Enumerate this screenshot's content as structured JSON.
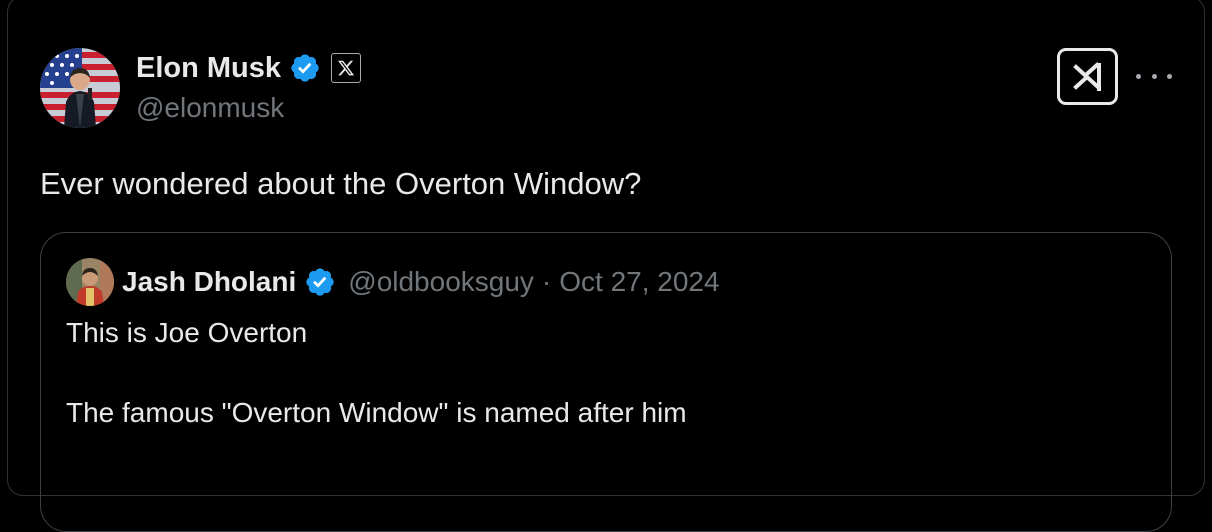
{
  "tweet": {
    "author_name": "Elon Musk",
    "author_handle": "@elonmusk",
    "text": "Ever wondered about the Overton Window?",
    "icons": {
      "verified": "verified-badge-icon",
      "affiliation": "x-logo-icon",
      "grok": "grok-icon",
      "more": "more-options-icon"
    }
  },
  "quoted_tweet": {
    "author_name": "Jash Dholani",
    "author_handle": "@oldbooksguy",
    "separator": "·",
    "date": "Oct 27, 2024",
    "lines": [
      "This is Joe Overton",
      "The famous \"Overton Window\" is named after him"
    ]
  },
  "colors": {
    "background": "#000000",
    "text": "#e7e9ea",
    "muted": "#71767b",
    "verified_blue": "#1d9bf0",
    "border": "#3c4043"
  }
}
